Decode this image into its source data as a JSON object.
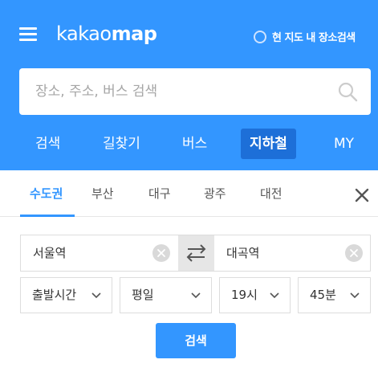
{
  "header": {
    "logo_part1": "kakao",
    "logo_part2": "map",
    "map_search_label": "현 지도 내 장소검색",
    "brand_color": "#3396ff",
    "active_tab_color": "#1d6fd8"
  },
  "search": {
    "placeholder": "장소, 주소, 버스 검색",
    "value": ""
  },
  "main_tabs": [
    {
      "label": "검색"
    },
    {
      "label": "길찾기"
    },
    {
      "label": "버스"
    },
    {
      "label": "지하철",
      "active": true
    },
    {
      "label": "MY"
    }
  ],
  "region_tabs": [
    {
      "label": "수도권",
      "active": true
    },
    {
      "label": "부산"
    },
    {
      "label": "대구"
    },
    {
      "label": "광주"
    },
    {
      "label": "대전"
    }
  ],
  "route": {
    "start": "서울역",
    "end": "대곡역"
  },
  "time_selects": {
    "type": "출발시간",
    "day": "평일",
    "hour": "19시",
    "minute": "45분"
  },
  "search_button_label": "검색",
  "icons": [
    "menu-icon",
    "radio-icon",
    "search-icon",
    "close-icon",
    "clear-icon",
    "swap-icon",
    "chevron-down-icon"
  ]
}
